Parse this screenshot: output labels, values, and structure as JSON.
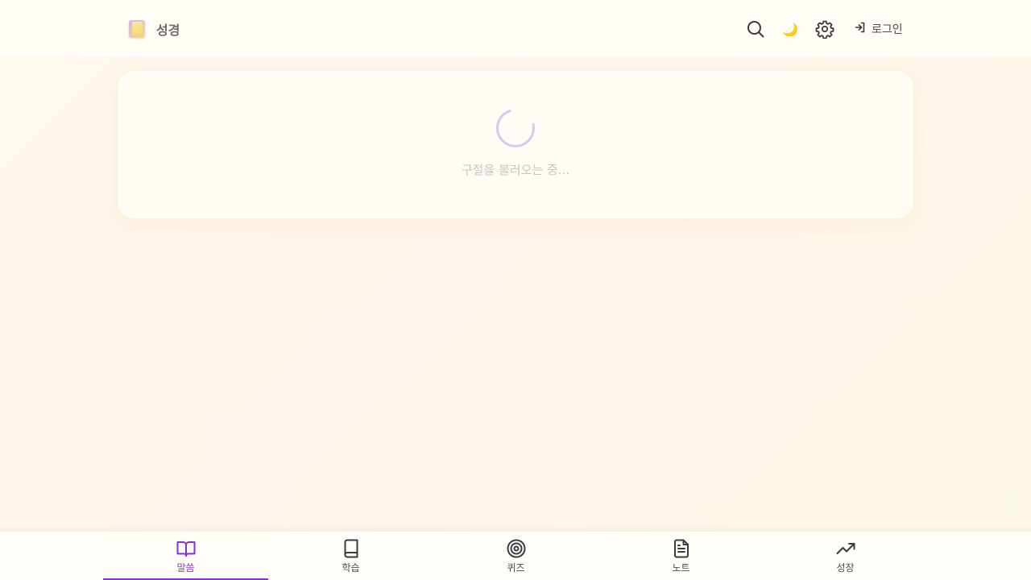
{
  "header": {
    "brand_title": "성경",
    "theme_icon": "🌙",
    "login_label": "로그인"
  },
  "main": {
    "loading_text": "구절을 불러오는 중..."
  },
  "bottom_nav": {
    "items": [
      {
        "label": "말씀",
        "icon": "open-book-icon",
        "active": true
      },
      {
        "label": "학습",
        "icon": "book-icon",
        "active": false
      },
      {
        "label": "퀴즈",
        "icon": "target-icon",
        "active": false
      },
      {
        "label": "노트",
        "icon": "document-icon",
        "active": false
      },
      {
        "label": "성장",
        "icon": "trending-up-icon",
        "active": false
      }
    ]
  },
  "colors": {
    "accent": "#8a2fd6",
    "spinner": "#dcc5f2"
  }
}
